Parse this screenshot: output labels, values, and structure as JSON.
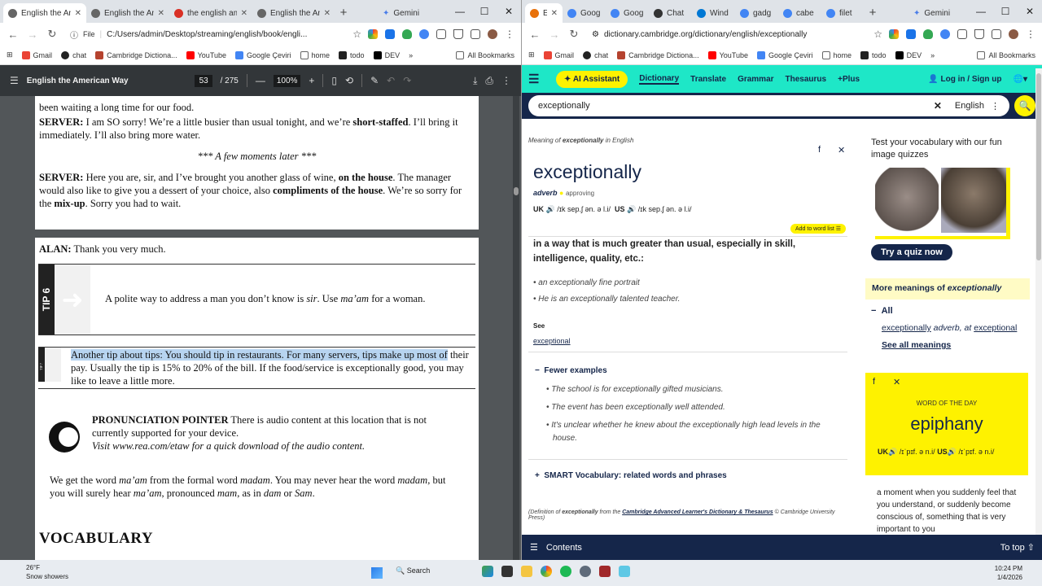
{
  "left_browser": {
    "tabs": [
      {
        "label": "English the Am",
        "active": true
      },
      {
        "label": "English the Am",
        "active": false
      },
      {
        "label": "the english am",
        "active": false
      },
      {
        "label": "English the Am",
        "active": false
      }
    ],
    "gemini": "Gemini",
    "file_chip": "File",
    "url": "C:/Users/admin/Desktop/streaming/english/book/engli...",
    "bookmarks": [
      "Gmail",
      "chat",
      "Cambridge Dictiona...",
      "YouTube",
      "Google Çeviri",
      "home",
      "todo",
      "DEV"
    ],
    "all_bookmarks": "All Bookmarks"
  },
  "pdf": {
    "title": "English the American Way",
    "page_current": "53",
    "page_total": "/ 275",
    "zoom": "100%",
    "page1": {
      "server_label": "SERVER:",
      "server_text_1": " I am SO sorry! We’re a little busier than usual tonight, and we’re ",
      "short_staffed": "short-staffed",
      "server_text_1b": ". I’ll bring it immediately. I’ll also bring more water.",
      "moments_later": "*** A few moments later ***",
      "server_text_2a": " Here you are, sir, and I’ve brought you another glass of wine, ",
      "on_the_house": "on the house",
      "server_text_2b": ". The manager would also like to give you a dessert of your choice, also ",
      "compliments": "compliments of the house",
      "server_text_2c": ". We’re so sorry for the ",
      "mix_up": "mix-up",
      "server_text_2d": ". Sorry you had to wait."
    },
    "page2": {
      "alan_label": "ALAN:",
      "alan_text": " Thank you very much.",
      "tip6_label": "TIP 6",
      "tip6_text_a": "A polite way to address a man you don’t know is ",
      "tip6_sir": "sir",
      "tip6_text_b": ". Use ",
      "tip6_maam": "ma’am",
      "tip6_text_c": " for a woman.",
      "tip7_label": "TIP 7",
      "tip7_highlight": "Another tip about tips: You should tip in restaurants. For many servers, tips make up most of",
      "tip7_rest": " their pay. Usually the tip is 15% to 20% of the bill. If the food/service is exceptionally good, you may like to leave a little more.",
      "pron_title": "PRONUNCIATION POINTER",
      "pron_text": " There is audio content at this location that is not currently supported for your device.",
      "pron_visit": "Visit www.rea.com/etaw for a quick download of the audio content.",
      "maam_a": "We get the word ",
      "maam_b": "ma’am",
      "maam_c": " from the formal word ",
      "maam_d": "madam",
      "maam_e": ". You may never hear the word ",
      "maam_f": "madam",
      "maam_g": ", but you will surely hear ",
      "maam_h": "ma’am",
      "maam_i": ", pronounced ",
      "maam_j": "mam",
      "maam_k": ", as in ",
      "maam_l": "dam",
      "maam_m": " or ",
      "maam_n": "Sam",
      "maam_o": ".",
      "vocab": "VOCABULARY"
    }
  },
  "right_browser": {
    "tabs": [
      "E",
      "Goog",
      "Goog",
      "Chat",
      "Wind",
      "gadg",
      "cabe",
      "filet"
    ],
    "gemini": "Gemini",
    "url": "dictionary.cambridge.org/dictionary/english/exceptionally",
    "bookmarks": [
      "Gmail",
      "chat",
      "Cambridge Dictiona...",
      "YouTube",
      "Google Çeviri",
      "home",
      "todo",
      "DEV"
    ],
    "all_bookmarks": "All Bookmarks"
  },
  "cambridge": {
    "nav": {
      "ai": "AI Assistant",
      "dictionary": "Dictionary",
      "translate": "Translate",
      "grammar": "Grammar",
      "thesaurus": "Thesaurus",
      "plus": "+Plus",
      "login": "Log in / Sign up"
    },
    "search": {
      "value": "exceptionally",
      "lang": "English"
    },
    "meaning_of_a": "Meaning of ",
    "meaning_of_b": "exceptionally",
    "meaning_of_c": " in English",
    "headword": "exceptionally",
    "pos": "adverb",
    "approving": "approving",
    "uk": "UK",
    "uk_ipa": "/ɪk sep.ʃ ən. ə l.i/",
    "us": "US",
    "us_ipa": "/ɪk sep.ʃ ən. ə l.i/",
    "add_to_list": "Add to word list",
    "definition": "in a way that is much greater than usual, especially in skill, intelligence, quality, etc.:",
    "examples": [
      "an exceptionally fine portrait",
      "He is an exceptionally talented teacher."
    ],
    "see_label": "See",
    "see_link": "exceptional",
    "fewer_examples": "Fewer examples",
    "more_examples": [
      "The school is for exceptionally gifted musicians.",
      "The event has been exceptionally well attended.",
      "It's unclear whether he knew about the exceptionally high lead levels in the house."
    ],
    "smart_vocab": "SMART Vocabulary: related words and phrases",
    "citation_a": "(Definition of ",
    "citation_b": "exceptionally",
    "citation_c": " from the ",
    "citation_d": "Cambridge Advanced Learner's Dictionary & Thesaurus",
    "citation_e": " © Cambridge University Press)",
    "quiz_title": "Test your vocabulary with our fun image quizzes",
    "quiz_button": "Try a quiz now",
    "more_meanings_a": "More meanings of ",
    "more_meanings_b": "exceptionally",
    "all_label": "All",
    "mm_word": "exceptionally",
    "mm_pos": " adverb, at ",
    "mm_link": "exceptional",
    "see_all": "See all meanings",
    "wotd_label": "WORD OF THE DAY",
    "wotd_word": "epiphany",
    "wotd_uk": "UK",
    "wotd_uk_ipa": "/ɪˈpɪf. ə n.i/",
    "wotd_us": "US",
    "wotd_us_ipa": "/ɪˈpɪf. ə n.i/",
    "wotd_def": "a moment when you suddenly feel that you understand, or suddenly become conscious of, something that is very important to you",
    "footer_contents": "Contents",
    "footer_top": "To top"
  },
  "taskbar": {
    "temp": "26°F",
    "weather": "Snow showers",
    "search": "Search",
    "time": "10:24 PM",
    "date": "1/4/2026"
  }
}
